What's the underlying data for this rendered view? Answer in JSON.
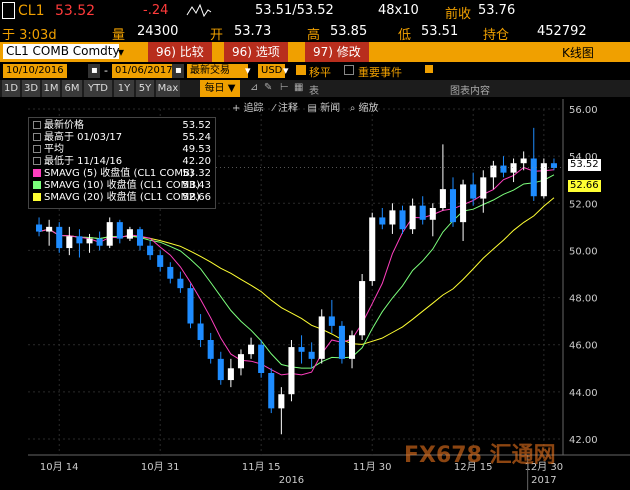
{
  "header": {
    "ticker": "CL1",
    "last": "53.52",
    "change": "-.24",
    "bid_ask": "53.51/53.52",
    "size": "48x10",
    "prev_label": "前收",
    "prev_value": "53.76"
  },
  "quote": {
    "time_label": "于 3:03d",
    "vol_label": "量",
    "vol_value": "24300",
    "open_label": "开",
    "open_value": "53.73",
    "high_label": "高",
    "high_value": "53.85",
    "low_label": "低",
    "low_value": "53.51",
    "oi_label": "持仓",
    "oi_value": "452792"
  },
  "toolbar": {
    "security": "CL1 COMB Comdty",
    "compare": "96) 比较",
    "options": "96) 选项",
    "edit": "97) 修改",
    "view": "K线图"
  },
  "range": {
    "start": "10/10/2016",
    "end": "01/06/2017",
    "period": "最新交易",
    "currency": "USD",
    "smooth_label": "移平",
    "events_label": "重要事件"
  },
  "zoom_buttons": [
    "1D",
    "3D",
    "1M",
    "6M",
    "YTD",
    "1Y",
    "5Y",
    "Max"
  ],
  "freq": "每日",
  "tools": {
    "track": "追踪",
    "annotate": "注释",
    "news": "新闻",
    "zoom": "缩放",
    "table": "表",
    "chart_content": "图表内容"
  },
  "legend": {
    "items": [
      {
        "label": "最新价格",
        "value": "53.52",
        "color": "#ffffff"
      },
      {
        "label": "最高于 01/03/17",
        "value": "55.24",
        "color": "#ffffff"
      },
      {
        "label": "平均",
        "value": "49.53",
        "color": "#ffffff"
      },
      {
        "label": "最低于 11/14/16",
        "value": "42.20",
        "color": "#ffffff"
      },
      {
        "label": "SMAVG (5)  收盘值 (CL1 COMB)",
        "value": "53.32",
        "color": "#ff3fbf"
      },
      {
        "label": "SMAVG (10) 收盘值 (CL1 COMB)",
        "value": "53.43",
        "color": "#7cff7c"
      },
      {
        "label": "SMAVG (20) 收盘值 (CL1 COMB)",
        "value": "52.66",
        "color": "#ffff33"
      }
    ]
  },
  "price_tags": {
    "last": "53.52",
    "sma20": "52.66"
  },
  "watermark": "FX678 汇通网",
  "chart_data": {
    "type": "candlestick",
    "ylim": [
      42,
      56
    ],
    "yticks": [
      "56.00",
      "54.00",
      "52.00",
      "50.00",
      "48.00",
      "46.00",
      "44.00",
      "42.00"
    ],
    "xticks": [
      "10月 14",
      "10月 31",
      "11月 15",
      "11月 30",
      "12月 15",
      "12月 30"
    ],
    "xticks_year": [
      "2016",
      "2017"
    ],
    "up_color": "#ffffff",
    "down_color": "#1e8cff",
    "candles": [
      [
        51.1,
        51.4,
        50.6,
        50.8
      ],
      [
        50.8,
        51.3,
        50.2,
        51.0
      ],
      [
        51.0,
        51.2,
        49.9,
        50.1
      ],
      [
        50.1,
        51.0,
        49.8,
        50.6
      ],
      [
        50.6,
        50.9,
        49.7,
        50.3
      ],
      [
        50.3,
        50.7,
        49.9,
        50.5
      ],
      [
        50.5,
        50.8,
        50.0,
        50.2
      ],
      [
        50.2,
        51.4,
        50.1,
        51.2
      ],
      [
        51.2,
        51.3,
        50.3,
        50.5
      ],
      [
        50.5,
        51.0,
        50.4,
        50.9
      ],
      [
        50.9,
        51.0,
        50.0,
        50.2
      ],
      [
        50.2,
        50.4,
        49.6,
        49.8
      ],
      [
        49.8,
        50.0,
        49.1,
        49.3
      ],
      [
        49.3,
        49.5,
        48.6,
        48.8
      ],
      [
        48.8,
        49.1,
        48.2,
        48.4
      ],
      [
        48.4,
        48.6,
        46.7,
        46.9
      ],
      [
        46.9,
        47.3,
        45.9,
        46.2
      ],
      [
        46.2,
        46.5,
        45.2,
        45.4
      ],
      [
        45.4,
        45.7,
        44.3,
        44.5
      ],
      [
        44.5,
        45.4,
        44.2,
        45.0
      ],
      [
        45.0,
        45.8,
        44.7,
        45.6
      ],
      [
        45.6,
        46.3,
        45.4,
        46.0
      ],
      [
        46.0,
        46.2,
        44.6,
        44.8
      ],
      [
        44.8,
        45.0,
        43.1,
        43.3
      ],
      [
        43.3,
        44.2,
        42.2,
        43.9
      ],
      [
        43.9,
        46.2,
        43.6,
        45.9
      ],
      [
        45.9,
        46.4,
        45.2,
        45.7
      ],
      [
        45.7,
        46.1,
        45.0,
        45.4
      ],
      [
        45.4,
        47.5,
        45.2,
        47.2
      ],
      [
        47.2,
        47.9,
        46.5,
        46.8
      ],
      [
        46.8,
        47.0,
        45.2,
        45.4
      ],
      [
        45.4,
        46.6,
        45.0,
        46.4
      ],
      [
        46.4,
        49.0,
        46.2,
        48.7
      ],
      [
        48.7,
        51.6,
        48.5,
        51.4
      ],
      [
        51.4,
        51.8,
        50.9,
        51.1
      ],
      [
        51.1,
        52.0,
        50.7,
        51.7
      ],
      [
        51.7,
        51.9,
        50.7,
        50.9
      ],
      [
        50.9,
        52.2,
        50.7,
        51.9
      ],
      [
        51.9,
        52.3,
        51.1,
        51.3
      ],
      [
        51.3,
        52.0,
        50.6,
        51.8
      ],
      [
        51.8,
        54.5,
        51.7,
        52.6
      ],
      [
        52.6,
        53.1,
        51.0,
        51.2
      ],
      [
        51.2,
        53.0,
        50.4,
        52.8
      ],
      [
        52.8,
        53.3,
        51.9,
        52.2
      ],
      [
        52.2,
        53.4,
        51.6,
        53.1
      ],
      [
        53.1,
        53.8,
        52.6,
        53.6
      ],
      [
        53.6,
        54.0,
        53.1,
        53.3
      ],
      [
        53.3,
        53.9,
        52.9,
        53.7
      ],
      [
        53.7,
        54.2,
        53.4,
        53.9
      ],
      [
        53.9,
        55.2,
        52.1,
        52.3
      ],
      [
        52.3,
        53.9,
        52.2,
        53.7
      ],
      [
        53.7,
        53.9,
        53.4,
        53.5
      ]
    ],
    "sma5_color": "#ff3fbf",
    "sma10_color": "#7cff7c",
    "sma20_color": "#ffff33"
  }
}
